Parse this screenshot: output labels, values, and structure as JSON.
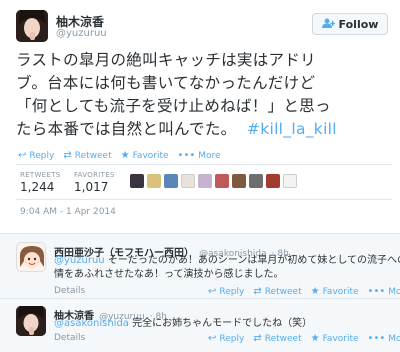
{
  "main_tweet": {
    "display_name": "柚木涼香",
    "handle": "@yuzuruu",
    "follow_label": "Follow",
    "text_lines": [
      "ラストの皐月の絶叫キャッチは実はアドリ",
      "ブ。台本には何も書いてなかったんだけど",
      "「何としても流子を受け止めねば！」と思っ",
      "たら本番では自然と叫んでた。"
    ],
    "hashtag": "#kill_la_kill",
    "actions": {
      "reply": "Reply",
      "retweet": "Retweet",
      "favorite": "Favorite",
      "more": "More"
    },
    "stats": {
      "retweets_label": "RETWEETS",
      "retweets_value": "1,244",
      "favorites_label": "FAVORITES",
      "favorites_value": "1,017"
    },
    "timestamp": "9:04 AM - 1 Apr 2014"
  },
  "replies": [
    {
      "display_name": "西田亜沙子（モフモハー西田）",
      "handle": "@asakonishida",
      "time": "· 8h",
      "mention": "@yuzuruu",
      "text_line1": " そーだったのかあ！あのシーンは皐月が初めて妹としての流子への愛",
      "text_line2": "情をあふれさせたなあ！って演技から感じました。",
      "details": "Details"
    },
    {
      "display_name": "柚木涼香",
      "handle": "@yuzuruu",
      "time": "· 8h",
      "mention": "@asakonishida",
      "text_line1": " 完全にお姉ちゃんモードでしたね（笑）",
      "details": "Details"
    }
  ],
  "reply_actions": {
    "reply": "Reply",
    "retweet": "Retweet",
    "favorite": "Favorite",
    "more": "More"
  },
  "colors": {
    "accent": "#55acee",
    "text": "#292f33",
    "muted": "#8899a6",
    "border": "#e1e8ed"
  },
  "icons": [
    "follow-person-icon",
    "reply-icon",
    "retweet-icon",
    "favorite-star-icon",
    "more-dots-icon"
  ]
}
